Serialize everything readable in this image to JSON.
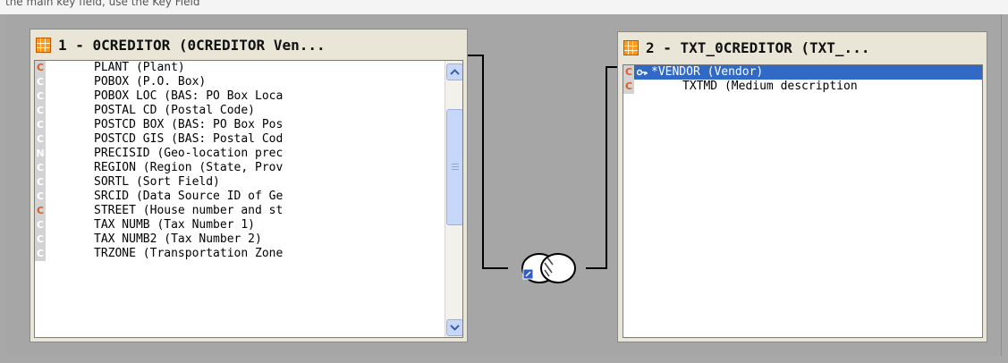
{
  "top_strip_text": "the main key field, use the Key Field",
  "tables": [
    {
      "title": "1 - 0CREDITOR (0CREDITOR Ven...",
      "rows": [
        {
          "type": "C",
          "field": "PLANT (Plant)",
          "key": true
        },
        {
          "type": "C",
          "field": "POBOX (P.O. Box)",
          "key": false
        },
        {
          "type": "C",
          "field": "POBOX LOC (BAS: PO Box Loca",
          "key": false
        },
        {
          "type": "C",
          "field": "POSTAL CD (Postal Code)",
          "key": false
        },
        {
          "type": "C",
          "field": "POSTCD BOX (BAS: PO Box Pos",
          "key": false
        },
        {
          "type": "C",
          "field": "POSTCD GIS (BAS: Postal Cod",
          "key": false
        },
        {
          "type": "N",
          "field": "PRECISID (Geo-location prec",
          "key": false
        },
        {
          "type": "C",
          "field": "REGION (Region (State, Prov",
          "key": false
        },
        {
          "type": "C",
          "field": "SORTL (Sort Field)",
          "key": false
        },
        {
          "type": "C",
          "field": "SRCID (Data Source ID of Ge",
          "key": false
        },
        {
          "type": "C",
          "field": "STREET (House number and st",
          "key": true
        },
        {
          "type": "C",
          "field": "TAX NUMB (Tax Number 1)",
          "key": false
        },
        {
          "type": "C",
          "field": "TAX NUMB2 (Tax Number 2)",
          "key": false
        },
        {
          "type": "C",
          "field": "TRZONE (Transportation Zone",
          "key": false
        }
      ]
    },
    {
      "title": "2 - TXT_0CREDITOR (TXT_...",
      "rows": [
        {
          "type": "C",
          "field": "*VENDOR (Vendor)",
          "key": true,
          "selected": true
        },
        {
          "type": "C",
          "field": "TXTMD (Medium description",
          "key": true,
          "selected": false
        }
      ]
    }
  ],
  "colors": {
    "background": "#a6a6a6",
    "box_fill": "#e9e6d8",
    "selection": "#3169c6",
    "key_badge": "#e05a1e",
    "scrollbar": "#c6d7fa"
  },
  "icons": [
    "table-icon",
    "key-icon",
    "join-icon",
    "scroll-up-icon",
    "scroll-down-icon"
  ]
}
